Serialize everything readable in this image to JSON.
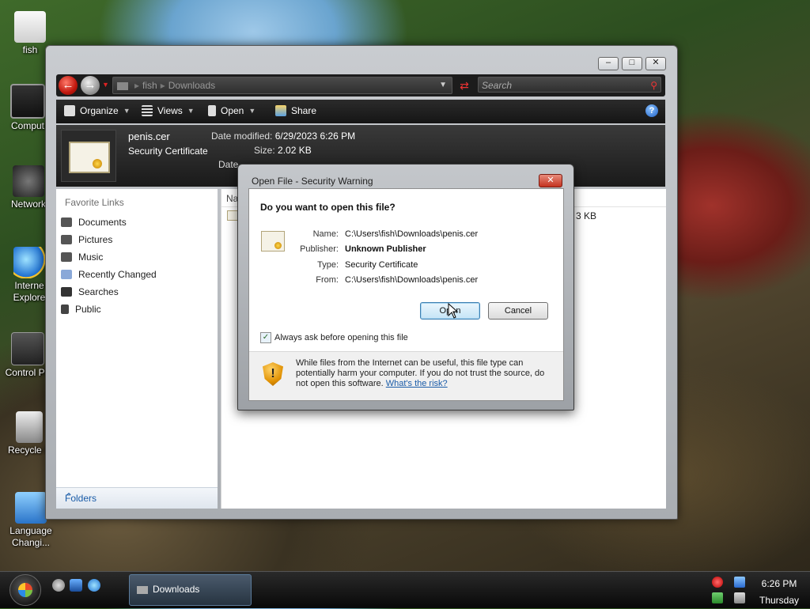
{
  "desktop": {
    "icons": [
      {
        "label": "fish"
      },
      {
        "label": "Comput"
      },
      {
        "label": "Network"
      },
      {
        "label": "Internet Explorer",
        "line1": "Interne",
        "line2": "Explore"
      },
      {
        "label": "Control Pa"
      },
      {
        "label": "Recycle B"
      },
      {
        "label": "Language Changi...",
        "line1": "Language",
        "line2": "Changi..."
      }
    ]
  },
  "explorer": {
    "breadcrumb": [
      "fish",
      "Downloads"
    ],
    "search_placeholder": "Search",
    "toolbar": {
      "organize": "Organize",
      "views": "Views",
      "open": "Open",
      "share": "Share"
    },
    "details": {
      "filename": "penis.cer",
      "filetype": "Security Certificate",
      "date_modified_label": "Date modified:",
      "date_modified": "6/29/2023 6:26 PM",
      "size_label": "Size:",
      "size": "2.02 KB",
      "date_created_label": "Date"
    },
    "favorite_links": {
      "title": "Favorite Links",
      "items": [
        "Documents",
        "Pictures",
        "Music",
        "Recently Changed",
        "Searches",
        "Public"
      ]
    },
    "folders_label": "Folders",
    "column_name": "Na",
    "row_size": "3 KB"
  },
  "dialog": {
    "title": "Open File - Security Warning",
    "question": "Do you want to open this file?",
    "fields": [
      {
        "label": "Name:",
        "value": "C:\\Users\\fish\\Downloads\\penis.cer",
        "bold": false
      },
      {
        "label": "Publisher:",
        "value": "Unknown Publisher",
        "bold": true
      },
      {
        "label": "Type:",
        "value": "Security Certificate",
        "bold": false
      },
      {
        "label": "From:",
        "value": "C:\\Users\\fish\\Downloads\\penis.cer",
        "bold": false
      }
    ],
    "open_button": "Open",
    "cancel_button": "Cancel",
    "checkbox_label": "Always ask before opening this file",
    "checkbox_checked": true,
    "warning_text": "While files from the Internet can be useful, this file type can potentially harm your computer. If you do not trust the source, do not open this software.",
    "risk_link": "What's the risk?"
  },
  "taskbar": {
    "task_button": "Downloads",
    "clock_time": "6:26 PM",
    "clock_day": "Thursday"
  },
  "colors": {
    "accent_link": "#1a5ca8",
    "back_button": "#c0170d"
  }
}
